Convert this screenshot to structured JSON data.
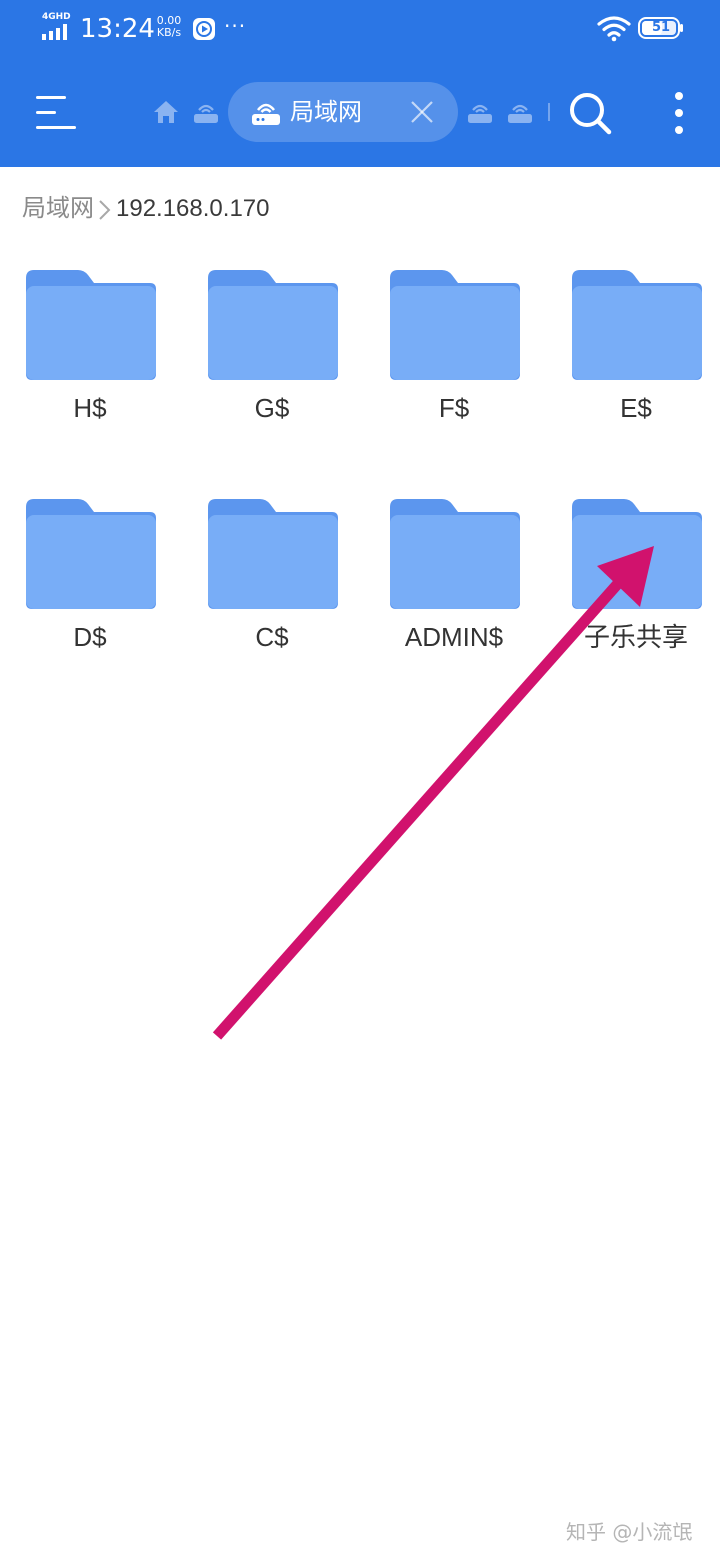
{
  "status_bar": {
    "network_type": "4GHD",
    "time": "13:24",
    "net_speed_value": "0.00",
    "net_speed_unit": "KB/s",
    "more_indicator": "···",
    "battery_level": "51",
    "icons": [
      "signal-icon",
      "play-icon",
      "wifi-icon",
      "battery-icon"
    ]
  },
  "toolbar": {
    "active_tab_label": "局域网",
    "icons": [
      "menu-icon",
      "home-icon",
      "lan-icon",
      "close-icon",
      "search-icon",
      "more-vert-icon"
    ]
  },
  "breadcrumb": {
    "root": "局域网",
    "current": "192.168.0.170",
    "separator_icon": "chevron-right-icon"
  },
  "folders": [
    {
      "name": "H$"
    },
    {
      "name": "G$"
    },
    {
      "name": "F$"
    },
    {
      "name": "E$"
    },
    {
      "name": "D$"
    },
    {
      "name": "C$"
    },
    {
      "name": "ADMIN$"
    },
    {
      "name": "子乐共享"
    }
  ],
  "colors": {
    "header_bg": "#2b76e5",
    "folder_front": "#78adf7",
    "folder_back": "#5c96ee",
    "annotation_arrow": "#d1126d",
    "text_primary": "#333333",
    "text_secondary": "#8a8a8a"
  },
  "watermark": "知乎 @小流氓"
}
